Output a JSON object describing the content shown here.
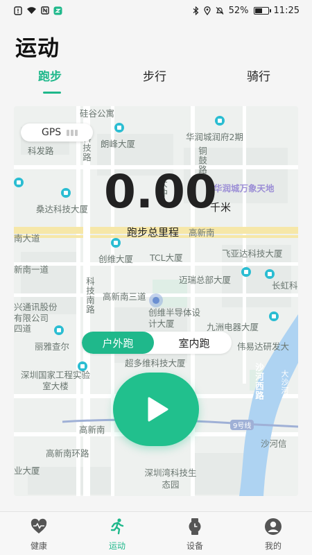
{
  "status_bar": {
    "battery_text": "52%",
    "time": "11:25",
    "battery_level": 0.52,
    "left_icons": [
      "notification-icon",
      "wifi-icon",
      "nfc-icon",
      "app-icon"
    ],
    "right_icons": [
      "bluetooth-icon",
      "location-icon",
      "mute-icon"
    ]
  },
  "page": {
    "title": "运动"
  },
  "tabs": [
    {
      "label": "跑步",
      "active": true
    },
    {
      "label": "步行",
      "active": false
    },
    {
      "label": "骑行",
      "active": false
    }
  ],
  "accent_color": "#1fb88b",
  "map": {
    "gps_label": "GPS",
    "labels": {
      "l1": "硅谷公寓",
      "l2": "科发路",
      "l3": "科技路",
      "l4": "朗峰大厦",
      "l5": "华润城润府2期",
      "l6": "铜鼓路",
      "l7": "大冲",
      "l8": "华润城万象天地",
      "l9": "桑达科技大厦",
      "l10": "南大道",
      "l11": "高新南",
      "l12": "创维大厦",
      "l13": "TCL大厦",
      "l14": "飞亚达科技大厦",
      "l15": "新南一道",
      "l16": "迈瑞总部大厦",
      "l17": "长虹科",
      "l18": "科技南路",
      "l19": "高新南三道",
      "l20": "兴通讯股份有限公司",
      "l21": "四道",
      "l22": "创维半导体设计大厦",
      "l23": "九洲电器大厦",
      "l24": "丽雅查尔",
      "l25": "伟易达研发大",
      "l26": "超多维科技大厦",
      "l27": "深圳国家工程实验室大楼",
      "l28": "沙河西路",
      "l29": "大沙河",
      "l30": "高新南",
      "l31": "9号线",
      "l32": "沙河信",
      "l33": "高新南环路",
      "l34": "业大厦",
      "l35": "深圳湾科技生态园"
    }
  },
  "run": {
    "distance": "0.00",
    "unit": "千米",
    "label": "跑步总里程"
  },
  "mode": {
    "outdoor": "户外跑",
    "indoor": "室内跑",
    "selected": "outdoor"
  },
  "bottom_nav": [
    {
      "label": "健康",
      "icon": "heart-pulse-icon",
      "active": false
    },
    {
      "label": "运动",
      "icon": "running-icon",
      "active": true
    },
    {
      "label": "设备",
      "icon": "watch-icon",
      "active": false
    },
    {
      "label": "我的",
      "icon": "profile-icon",
      "active": false
    }
  ]
}
